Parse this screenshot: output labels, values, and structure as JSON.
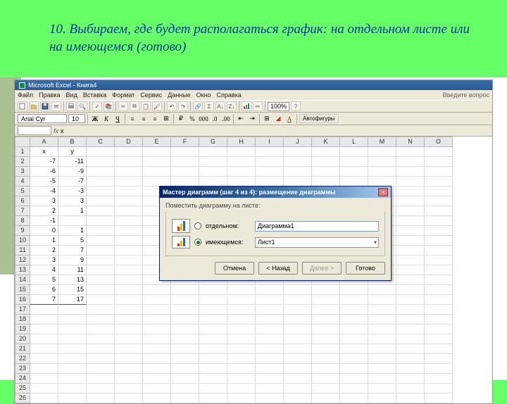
{
  "heading": "10. Выбираем, где будет располагаться график: на отдельном листе или на имеющемся    (готово)",
  "titlebar": {
    "text": "Microsoft Excel - Книга4"
  },
  "menu": {
    "items": [
      "Файл",
      "Правка",
      "Вид",
      "Вставка",
      "Формат",
      "Сервис",
      "Данные",
      "Окно",
      "Справка"
    ],
    "question": "Введите вопрос"
  },
  "toolbar": {
    "zoom": "100%",
    "autoshape": "Автофигуры"
  },
  "format": {
    "font": "Arial Cyr",
    "size": "10",
    "bold": "Ж",
    "italic": "К",
    "underline": "Ч"
  },
  "formula": {
    "namebox": "",
    "fx": "fx",
    "value": "x"
  },
  "columns": [
    "A",
    "B",
    "C",
    "D",
    "E",
    "F",
    "G",
    "H",
    "I",
    "J",
    "K",
    "L",
    "M",
    "N",
    "O"
  ],
  "data": {
    "header": [
      "x",
      "y"
    ],
    "rows": [
      [
        "-7",
        "-11"
      ],
      [
        "-6",
        "-9"
      ],
      [
        "-5",
        "-7"
      ],
      [
        "-4",
        "-3"
      ],
      [
        "3",
        "3"
      ],
      [
        "2",
        "1"
      ],
      [
        "-1",
        ""
      ],
      [
        "0",
        "1"
      ],
      [
        "1",
        "5"
      ],
      [
        "2",
        "7"
      ],
      [
        "3",
        "9"
      ],
      [
        "4",
        "11"
      ],
      [
        "5",
        "13"
      ],
      [
        "6",
        "15"
      ],
      [
        "7",
        "17"
      ]
    ]
  },
  "rowcount": 26,
  "dialog": {
    "title": "Мастер диаграмм (шаг 4 из 4): размещение диаграммы",
    "group_label": "Поместить диаграмму на листе:",
    "opt1_label": "отдельном:",
    "opt1_value": "Диаграмма1",
    "opt2_label": "имеющемся:",
    "opt2_value": "Лист1",
    "btn_cancel": "Отмена",
    "btn_back": "< Назад",
    "btn_next": "Далее >",
    "btn_finish": "Готово"
  }
}
